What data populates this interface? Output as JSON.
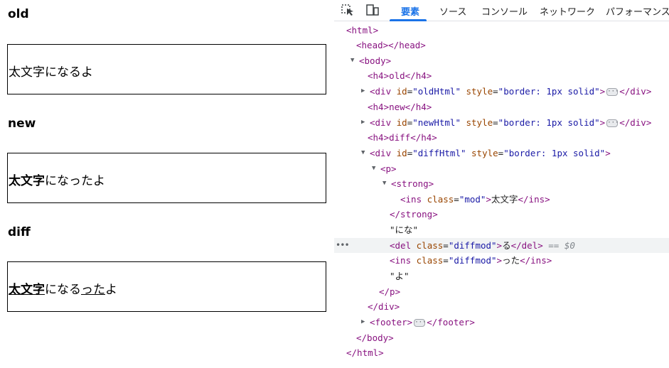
{
  "page": {
    "h_old": "old",
    "h_new": "new",
    "h_diff": "diff",
    "old_text": "太文字になるよ",
    "new_bold": "太文字",
    "new_rest": "になったよ",
    "diff_bold": "太文字",
    "diff_mid": "にな",
    "diff_del": "る",
    "diff_ins": "った",
    "diff_end": "よ"
  },
  "devtools": {
    "tabs": [
      "要素",
      "ソース",
      "コンソール",
      "ネットワーク",
      "パフォーマンス"
    ],
    "active_tab": "要素",
    "accent": "#1a73e8",
    "lines": {
      "html_open": "<html>",
      "head": "<head></head>",
      "body_open": "<body>",
      "h4_old": "<h4>old</h4>",
      "div_old_tag": "div",
      "div_old_id_attr": "id",
      "div_old_id_val": "\"oldHtml\"",
      "div_old_style_attr": "style",
      "div_old_style_val": "\"border: 1px solid\"",
      "div_close": "</div>",
      "h4_new": "<h4>new</h4>",
      "div_new_id_val": "\"newHtml\"",
      "h4_diff": "<h4>diff</h4>",
      "div_diff_id_val": "\"diffHtml\"",
      "p_open": "<p>",
      "strong_open": "<strong>",
      "ins_class_val": "\"mod\"",
      "ins_text": "太文字",
      "ins_close": "</ins>",
      "strong_close": "</strong>",
      "text_nina": "\"にな\"",
      "del_class_val": "\"diffmod\"",
      "del_text": "る",
      "del_close": "</del>",
      "eq_hint": "== $0",
      "ins2_class_val": "\"diffmod\"",
      "ins2_text": "った",
      "text_yo": "\"よ\"",
      "p_close": "</p>",
      "div_close2": "</div>",
      "footer_open": "<footer>",
      "footer_close": "</footer>",
      "body_close": "</body>",
      "html_close": "</html>"
    }
  }
}
